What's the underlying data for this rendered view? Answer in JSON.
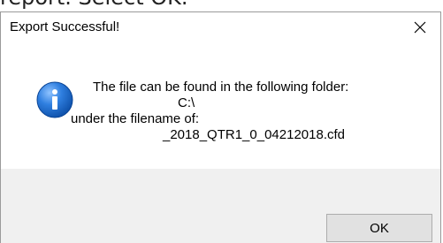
{
  "background": {
    "caption": "report. Select OK."
  },
  "dialog": {
    "title": "Export Successful!",
    "close_icon": "close-icon",
    "info_icon": "info-icon",
    "message": {
      "line1": "The file can be found in the following folder:",
      "folder": "C:\\",
      "line3": "under the filename of:",
      "filename": "_2018_QTR1_0_04212018.cfd"
    },
    "ok_label": "OK"
  },
  "colors": {
    "footer_bg": "#f0f0f0",
    "icon_blue": "#1e6fd0",
    "button_bg": "#e1e1e1",
    "button_border": "#adadad"
  }
}
